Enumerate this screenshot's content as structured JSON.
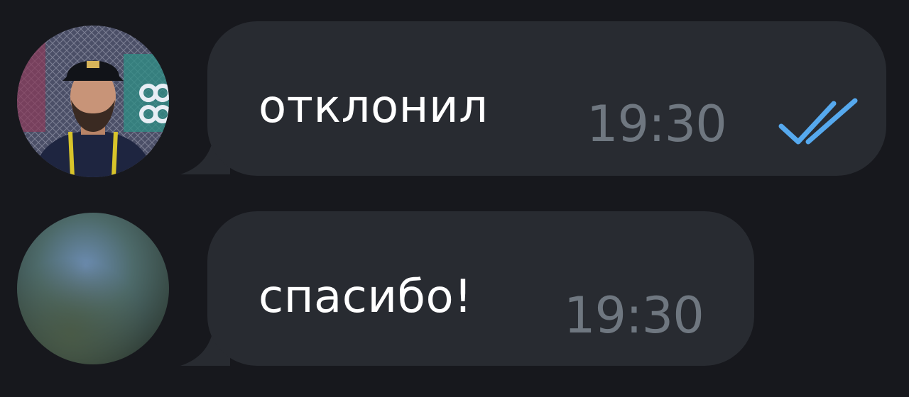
{
  "messages": [
    {
      "text": "отклонил",
      "time": "19:30",
      "status_icon": "double-check-icon",
      "status_color": "#56a9ee"
    },
    {
      "text": "спасибо!",
      "time": "19:30"
    }
  ],
  "colors": {
    "background": "#17181d",
    "bubble": "#282b31",
    "text": "#ffffff",
    "time": "#6f7780",
    "read_check": "#56a9ee"
  }
}
